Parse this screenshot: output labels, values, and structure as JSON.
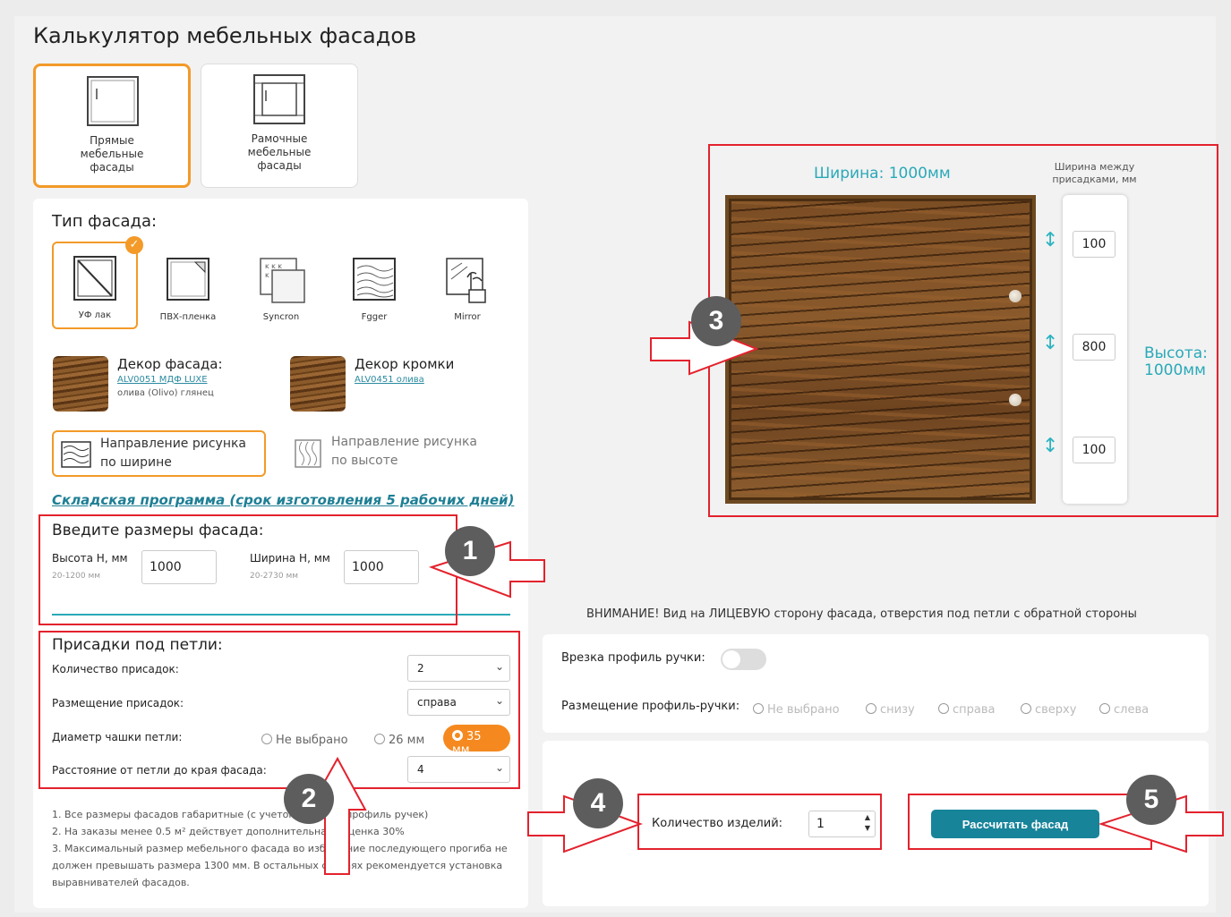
{
  "page_title": "Калькулятор мебельных фасадов",
  "tabs": [
    {
      "label": "Прямые\nмебельные\nфасады",
      "active": true
    },
    {
      "label": "Рамочные\nмебельные\nфасады",
      "active": false
    }
  ],
  "facade_type": {
    "heading": "Тип фасада:",
    "options": [
      {
        "label": "УФ лак",
        "selected": true
      },
      {
        "label": "ПВХ-пленка",
        "selected": false
      },
      {
        "label": "Syncron",
        "selected": false
      },
      {
        "label": "Fgger",
        "selected": false
      },
      {
        "label": "Mirror",
        "selected": false
      }
    ]
  },
  "decor": {
    "facade": {
      "heading": "Декор фасада:",
      "link": "ALV0051 МДФ LUXE",
      "sub": "олива (Olivo) глянец"
    },
    "edge": {
      "heading": "Декор кромки",
      "link": "ALV0451 олива"
    }
  },
  "direction": {
    "width_label": "Направление рисунка по ширине",
    "height_label": "Направление рисунка по высоте"
  },
  "stock_link": "Складская программа (срок изготовления 5 рабочих дней)",
  "sizes": {
    "heading": "Введите размеры фасада:",
    "height_label": "Высота Н, мм",
    "height_range": "20-1200 мм",
    "height_value": "1000",
    "width_label": "Ширина Н, мм",
    "width_range": "20-2730 мм",
    "width_value": "1000"
  },
  "hinges": {
    "heading": "Присадки под петли:",
    "count_label": "Количество присадок:",
    "count_value": "2",
    "placement_label": "Размещение присадок:",
    "placement_value": "справа",
    "cup_label": "Диаметр чашки петли:",
    "cup_options": [
      "Не выбрано",
      "26 мм",
      "35 мм"
    ],
    "cup_selected": "35 мм",
    "distance_label": "Расстояние от петли до края фасада:",
    "distance_value": "4"
  },
  "notes": [
    "1. Все размеры фасадов габаритные (с учетом врезных профиль ручек)",
    "2. На заказы менее 0.5 м² действует дополнительная наценка 30%",
    "3. Максимальный размер мебельного фасада во избежание последующего прогиба не должен превышать размера 1300 мм. В остальных случаях рекомендуется установка выравнивателей фасадов."
  ],
  "preview": {
    "width_caption": "Ширина: 1000мм",
    "height_caption": "Высота: 1000мм",
    "spacing_caption": "Ширина между присадками, мм",
    "spacing_values": [
      "100",
      "800",
      "100"
    ]
  },
  "warning": "ВНИМАНИЕ! Вид на ЛИЦЕВУЮ сторону фасада, отверстия под петли с обратной стороны",
  "handle": {
    "cut_label": "Врезка профиль ручки:",
    "cut_enabled": false,
    "placement_label": "Размещение профиль-ручки:",
    "placement_options": [
      "Не выбрано",
      "снизу",
      "справа",
      "сверху",
      "слева"
    ]
  },
  "quantity": {
    "label": "Количество изделий:",
    "value": "1"
  },
  "calculate_button": "Рассчитать фасад",
  "callouts": [
    "1",
    "2",
    "3",
    "4",
    "5"
  ],
  "colors": {
    "accent": "#f39a28",
    "teal": "#17849a",
    "callout_red": "#e3222d",
    "callout_grey": "#5d5d5d"
  }
}
